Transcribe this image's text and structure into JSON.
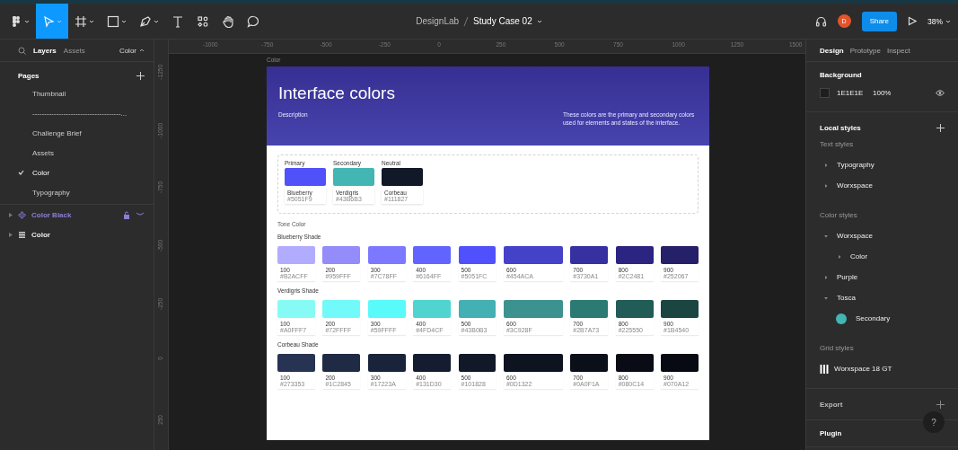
{
  "toolbar": {
    "tools": [
      {
        "kind": "logo",
        "selected": false,
        "caret": true
      },
      {
        "kind": "move",
        "selected": true,
        "caret": true
      },
      {
        "kind": "frame",
        "selected": false,
        "caret": true
      },
      {
        "kind": "shape",
        "selected": false,
        "caret": true
      },
      {
        "kind": "pen",
        "selected": false,
        "caret": true
      },
      {
        "kind": "text",
        "selected": false,
        "caret": false
      },
      {
        "kind": "resources",
        "selected": false,
        "caret": false
      },
      {
        "kind": "hand",
        "selected": false,
        "caret": false
      },
      {
        "kind": "comment",
        "selected": false,
        "caret": false
      }
    ],
    "project": "DesignLab",
    "file_name": "Study Case 02",
    "avatar": "D",
    "share": "Share",
    "zoom": "38%"
  },
  "left_panel": {
    "tabs": [
      {
        "label": "Layers",
        "selected": true
      },
      {
        "label": "Assets",
        "selected": false
      }
    ],
    "page_menu": "Color",
    "pages_title": "Pages",
    "pages": [
      {
        "label": "Thumbnail",
        "selected": false
      },
      {
        "label": "-------------------------------------...",
        "selected": false
      },
      {
        "label": "Challenge Brief",
        "selected": false
      },
      {
        "label": "Assets",
        "selected": false
      },
      {
        "label": "Color",
        "selected": true
      },
      {
        "label": "Typography",
        "selected": false
      }
    ],
    "layers": [
      {
        "name": "Color Black",
        "kind": "component"
      },
      {
        "name": "Color",
        "kind": "frame"
      }
    ]
  },
  "rulers": {
    "horizontal": [
      "-1000",
      "-750",
      "-500",
      "-250",
      "0",
      "250",
      "500",
      "750",
      "1000",
      "1250",
      "1500"
    ],
    "vertical": [
      "-1250",
      "-1000",
      "-750",
      "-500",
      "-250",
      "0",
      "250"
    ]
  },
  "frame": {
    "label": "Color",
    "title": "Interface colors",
    "description_label": "Description",
    "description": "These colors are the primary and secondary colors used for elements and states of the interface.",
    "main_colors": [
      {
        "label": "Primary",
        "name": "Blueberry",
        "hex": "#5051F9",
        "color": "#5051f9"
      },
      {
        "label": "Secondary",
        "name": "Verdigris",
        "hex": "#43B6B3",
        "color": "#43b6b3"
      },
      {
        "label": "Neutral",
        "name": "Corbeau",
        "hex": "#111827",
        "color": "#111827"
      }
    ],
    "tone_title": "Tone Color",
    "shades": [
      {
        "title": "Blueberry Shade",
        "swatches": [
          {
            "step": "100",
            "hex": "#B2ACFF",
            "color": "#b2acff"
          },
          {
            "step": "200",
            "hex": "#959FFF",
            "color": "#938cfa"
          },
          {
            "step": "300",
            "hex": "#7C78FF",
            "color": "#7c78ff"
          },
          {
            "step": "400",
            "hex": "#6164FF",
            "color": "#6164ff"
          },
          {
            "step": "500",
            "hex": "#5051FC",
            "color": "#5051fc"
          },
          {
            "step": "600",
            "hex": "#454ACA",
            "color": "#4542ca"
          },
          {
            "step": "700",
            "hex": "#3730A1",
            "color": "#3730a1"
          },
          {
            "step": "800",
            "hex": "#2C2481",
            "color": "#2c2481"
          },
          {
            "step": "900",
            "hex": "#252067",
            "color": "#252067"
          }
        ]
      },
      {
        "title": "Verdigris Shade",
        "swatches": [
          {
            "step": "100",
            "hex": "#A0FFF7",
            "color": "#86fbf5"
          },
          {
            "step": "200",
            "hex": "#72FFFF",
            "color": "#72fafa"
          },
          {
            "step": "300",
            "hex": "#59FFFF",
            "color": "#59fafa"
          },
          {
            "step": "400",
            "hex": "#4FD4CF",
            "color": "#4fd4cf"
          },
          {
            "step": "500",
            "hex": "#43B0B3",
            "color": "#43b0b3"
          },
          {
            "step": "600",
            "hex": "#3C928F",
            "color": "#3c928f"
          },
          {
            "step": "700",
            "hex": "#2B7A73",
            "color": "#2b7a73"
          },
          {
            "step": "800",
            "hex": "#225550",
            "color": "#225c56"
          },
          {
            "step": "900",
            "hex": "#1B4540",
            "color": "#1b4540"
          }
        ]
      },
      {
        "title": "Corbeau Shade",
        "swatches": [
          {
            "step": "100",
            "hex": "#273353",
            "color": "#273353"
          },
          {
            "step": "200",
            "hex": "#1C2845",
            "color": "#1f2a45"
          },
          {
            "step": "300",
            "hex": "#17223A",
            "color": "#19233a"
          },
          {
            "step": "400",
            "hex": "#131D30",
            "color": "#141d30"
          },
          {
            "step": "500",
            "hex": "#101828",
            "color": "#111827"
          },
          {
            "step": "600",
            "hex": "#0D1322",
            "color": "#0e1320"
          },
          {
            "step": "700",
            "hex": "#0A0F1A",
            "color": "#0b0f1a"
          },
          {
            "step": "800",
            "hex": "#080C14",
            "color": "#090c14"
          },
          {
            "step": "900",
            "hex": "#070A12",
            "color": "#070a12"
          }
        ]
      }
    ]
  },
  "right_panel": {
    "tabs": [
      {
        "label": "Design",
        "selected": true
      },
      {
        "label": "Prototype",
        "selected": false
      },
      {
        "label": "Inspect",
        "selected": false
      }
    ],
    "background": {
      "title": "Background",
      "hex": "1E1E1E",
      "opacity": "100%",
      "color": "#1e1e1e"
    },
    "local_styles": "Local styles",
    "text_styles": {
      "title": "Text styles",
      "items": [
        {
          "label": "Typography",
          "expanded": false
        },
        {
          "label": "Worxspace",
          "expanded": false
        }
      ]
    },
    "color_styles": {
      "title": "Color styles",
      "items": [
        {
          "label": "Worxspace",
          "expanded": true,
          "children": [
            {
              "label": "Color",
              "expanded": false
            }
          ]
        },
        {
          "label": "Purple",
          "expanded": false
        },
        {
          "label": "Tosca",
          "expanded": true,
          "children": [
            {
              "label": "Secondary",
              "color": "#43b6b3"
            }
          ]
        }
      ]
    },
    "grid_styles": {
      "title": "Grid styles",
      "items": [
        {
          "label": "Worxspace 18 GT"
        }
      ]
    },
    "export": "Export",
    "plugin": "Plugin",
    "help": "?"
  }
}
